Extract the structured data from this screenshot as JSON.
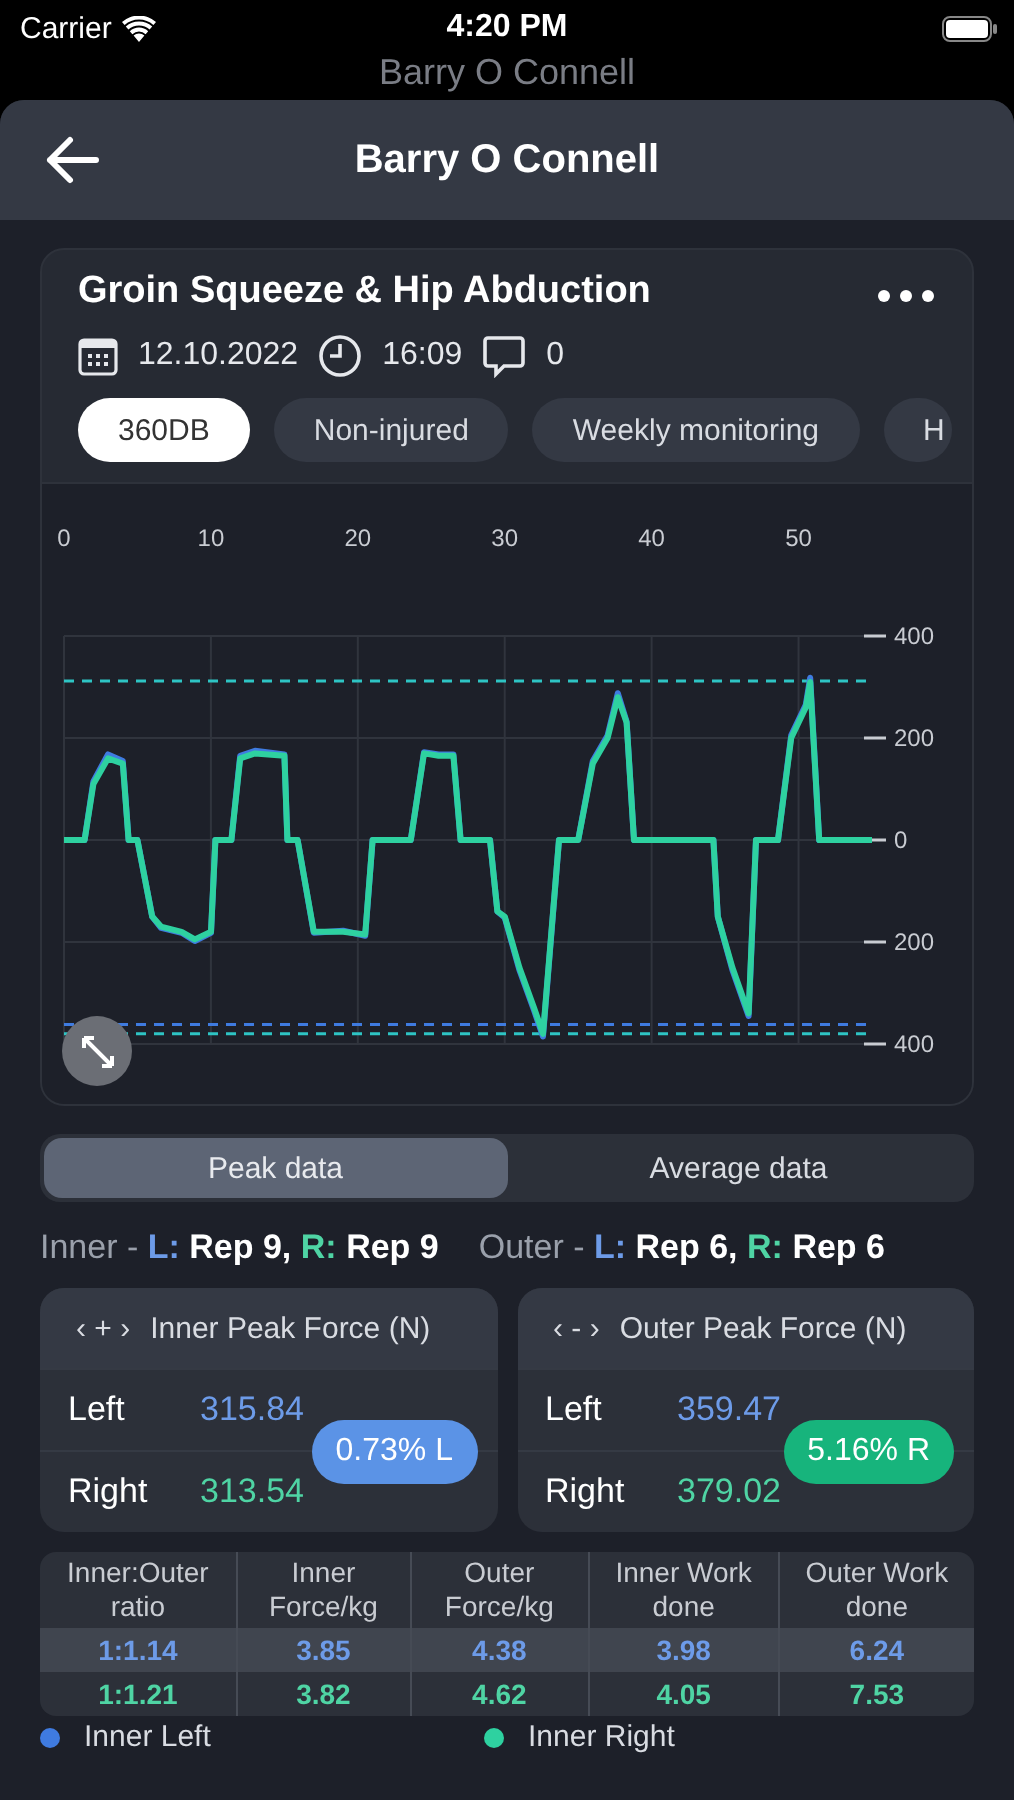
{
  "status_bar": {
    "carrier": "Carrier",
    "time": "4:20 PM"
  },
  "background_title": "Barry O Connell",
  "header": {
    "title": "Barry O Connell"
  },
  "test_card": {
    "title": "Groin Squeeze & Hip Abduction",
    "date": "12.10.2022",
    "time": "16:09",
    "comments": "0",
    "tags": [
      {
        "label": "360DB",
        "selected": true
      },
      {
        "label": "Non-injured",
        "selected": false
      },
      {
        "label": "Weekly monitoring",
        "selected": false
      },
      {
        "label": "H",
        "selected": false
      }
    ],
    "chart_data": {
      "type": "line",
      "x": [
        0,
        1.4,
        2,
        3,
        4,
        4.4,
        5,
        6,
        6.6,
        8,
        8.9,
        10,
        10.3,
        11.4,
        12,
        13,
        15,
        15.2,
        15.9,
        17,
        19,
        20.5,
        21,
        23.6,
        24.5,
        25.5,
        26.5,
        27,
        29,
        29.5,
        30,
        31,
        32,
        32.6,
        33.7,
        35,
        36,
        37,
        37.7,
        38.3,
        38.8,
        44.2,
        44.5,
        45.5,
        46.6,
        47.1,
        48.6,
        49.5,
        50.5,
        50.8,
        51.4,
        55
      ],
      "series": [
        {
          "name": "Inner Left",
          "color": "#3f7be0",
          "values": [
            0,
            0,
            115,
            168,
            155,
            0,
            0,
            -150,
            -172,
            -182,
            -198,
            -182,
            0,
            0,
            165,
            175,
            168,
            0,
            0,
            -182,
            -178,
            -188,
            0,
            0,
            172,
            168,
            168,
            0,
            0,
            -140,
            -152,
            -255,
            -335,
            -385,
            0,
            0,
            155,
            205,
            288,
            232,
            0,
            0,
            -150,
            -255,
            -345,
            0,
            0,
            205,
            265,
            318,
            0,
            0
          ]
        },
        {
          "name": "Inner Right",
          "color": "#2ed1a0",
          "values": [
            0,
            0,
            110,
            160,
            150,
            0,
            0,
            -150,
            -170,
            -180,
            -195,
            -180,
            0,
            0,
            160,
            170,
            165,
            0,
            0,
            -180,
            -180,
            -185,
            0,
            0,
            170,
            165,
            165,
            0,
            0,
            -140,
            -150,
            -250,
            -330,
            -380,
            0,
            0,
            150,
            200,
            280,
            230,
            0,
            0,
            -150,
            -250,
            -340,
            0,
            0,
            200,
            260,
            310,
            0,
            0
          ]
        }
      ],
      "xlim": [
        0,
        55
      ],
      "ylim": [
        -400,
        400
      ],
      "xticks": [
        0,
        10,
        20,
        30,
        40,
        50
      ],
      "yticks": [
        {
          "value": 400,
          "label": "400"
        },
        {
          "value": 200,
          "label": "200"
        },
        {
          "value": 0,
          "label": "0"
        },
        {
          "value": -200,
          "label": "200"
        },
        {
          "value": -400,
          "label": "400"
        }
      ],
      "grid": true,
      "ref_lines": [
        {
          "axis": "y",
          "value": 312,
          "color": "#2ec4c4"
        },
        {
          "axis": "y",
          "value": -362,
          "color": "#3f7be0"
        },
        {
          "axis": "y",
          "value": -380,
          "color": "#2ec4c4"
        }
      ]
    }
  },
  "data_modes": [
    {
      "label": "Peak data",
      "selected": true
    },
    {
      "label": "Average data",
      "selected": false
    }
  ],
  "rep_summaries": [
    [
      {
        "text": "Inner - ",
        "kind": "muted"
      },
      {
        "text": "L: ",
        "kind": "left"
      },
      {
        "text": "Rep 9, ",
        "kind": "strong"
      },
      {
        "text": "R: ",
        "kind": "right"
      },
      {
        "text": "Rep 9",
        "kind": "strong"
      }
    ],
    [
      {
        "text": "Outer - ",
        "kind": "muted"
      },
      {
        "text": "L: ",
        "kind": "left"
      },
      {
        "text": "Rep 6, ",
        "kind": "strong"
      },
      {
        "text": "R: ",
        "kind": "right"
      },
      {
        "text": "Rep 6",
        "kind": "strong"
      }
    ]
  ],
  "force_cards": [
    {
      "symbol": "‹ + ›",
      "title": "Inner Peak Force (N)",
      "left_label": "Left",
      "left_value": "315.84",
      "right_label": "Right",
      "right_value": "313.54",
      "badge": "0.73% L",
      "color": "#5b93e6"
    },
    {
      "symbol": "‹ - ›",
      "title": "Outer Peak Force (N)",
      "left_label": "Left",
      "left_value": "359.47",
      "right_label": "Right",
      "right_value": "379.02",
      "badge": "5.16% R",
      "color": "#17b47c"
    }
  ],
  "table": {
    "columns": [
      "Inner:Outer ratio",
      "Inner Force/kg",
      "Outer Force/kg",
      "Inner Work done",
      "Outer Work done"
    ],
    "rows": [
      {
        "selected": true,
        "color": "#6d9be8",
        "cells": [
          "1:1.14",
          "3.85",
          "4.38",
          "3.98",
          "6.24"
        ]
      },
      {
        "selected": false,
        "color": "#4fd4a4",
        "cells": [
          "1:1.21",
          "3.82",
          "4.62",
          "4.05",
          "7.53"
        ]
      }
    ]
  }
}
